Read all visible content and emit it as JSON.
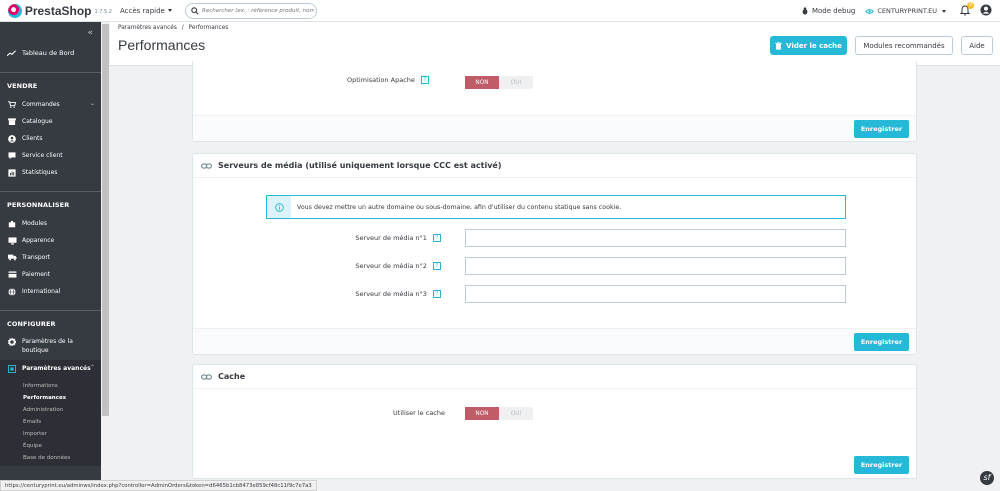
{
  "brand": {
    "name": "PrestaShop",
    "version": "1.7.5.2"
  },
  "topbar": {
    "quick_access": "Accès rapide",
    "search_placeholder": "Rechercher (ex. : référence produit, nom",
    "debug_mode": "Mode debug",
    "shop_name": "CENTURYPRINT.EU",
    "notifications_count": "9"
  },
  "sidebar": {
    "dashboard": "Tableau de Bord",
    "sections": [
      {
        "title": "VENDRE",
        "items": [
          "Commandes",
          "Catalogue",
          "Clients",
          "Service client",
          "Statistiques"
        ]
      },
      {
        "title": "PERSONNALISER",
        "items": [
          "Modules",
          "Apparence",
          "Transport",
          "Paiement",
          "International"
        ]
      },
      {
        "title": "CONFIGURER",
        "items": [
          "Paramètres de la boutique",
          "Paramètres avancés"
        ]
      }
    ],
    "advanced_sub": [
      "Informations",
      "Performances",
      "Administration",
      "Emails",
      "Importer",
      "Équipe",
      "Base de données"
    ]
  },
  "header": {
    "breadcrumb_parent": "Paramètres avancés",
    "breadcrumb_separator": "/",
    "breadcrumb_current": "Performances",
    "title": "Performances",
    "clear_cache": "Vider le cache",
    "recommended_modules": "Modules recommandés",
    "help": "Aide"
  },
  "panels": {
    "apache": {
      "label": "Optimisation Apache",
      "no": "NON",
      "yes": "OUI",
      "save": "Enregistrer"
    },
    "media": {
      "title": "Serveurs de média (utilisé uniquement lorsque CCC est activé)",
      "alert": "Vous devez mettre un autre domaine ou sous-domaine, afin d'utiliser du contenu statique sans cookie.",
      "server1": "Serveur de média n°1",
      "server2": "Serveur de média n°2",
      "server3": "Serveur de média n°3",
      "save": "Enregistrer"
    },
    "cache": {
      "title": "Cache",
      "label": "Utiliser le cache",
      "no": "NON",
      "yes": "OUI",
      "save": "Enregistrer"
    }
  },
  "statusbar": {
    "url": "https://centuryprint.eu/adminws/index.php?controller=AdminOrders&token=d6465b1cb8473e859cf48c11f9c7e7a3"
  },
  "colors": {
    "accent": "#25b9d7",
    "sidebar": "#363a41",
    "toggle_off_selected": "#c05c67"
  }
}
